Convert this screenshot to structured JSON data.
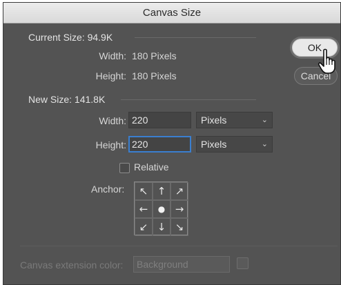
{
  "window": {
    "title": "Canvas Size"
  },
  "current_size": {
    "heading": "Current Size: 94.9K",
    "width_label": "Width:",
    "width_value": "180 Pixels",
    "height_label": "Height:",
    "height_value": "180 Pixels"
  },
  "new_size": {
    "heading": "New Size: 141.8K",
    "width_label": "Width:",
    "width_value": "220",
    "width_unit": "Pixels",
    "height_label": "Height:",
    "height_value": "220",
    "height_unit": "Pixels",
    "relative_label": "Relative",
    "relative_checked": false,
    "anchor_label": "Anchor:",
    "anchor_arrows": [
      "↖",
      "↑",
      "↗",
      "←",
      "●",
      "→",
      "↙",
      "↓",
      "↘"
    ]
  },
  "buttons": {
    "ok": "OK",
    "cancel": "Cancel"
  },
  "extension": {
    "label": "Canvas extension color:",
    "value": "Background"
  }
}
